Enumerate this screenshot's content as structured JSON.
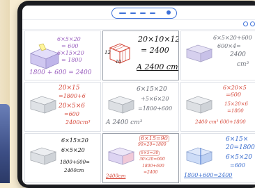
{
  "app": {
    "title": "",
    "breadcrumbs": []
  },
  "toolbar": {
    "tool_icon": "pen-icon"
  },
  "cells": [
    {
      "lines": [
        "6×5×20",
        "= 600",
        "6×15×20",
        "= 1800",
        "1800 + 600 = 2400"
      ],
      "color": "purple"
    },
    {
      "lines": [
        "20×10×12",
        "= 2400",
        "A 2400 cm³"
      ],
      "labels": [
        "12",
        "10"
      ],
      "color": "black"
    },
    {
      "lines": [
        "6×5×20+600",
        "600×4=",
        "2400",
        "cm³"
      ],
      "color": "gray"
    },
    {
      "lines": [
        "20×15",
        "=1800+6",
        "20×5×6",
        "=600",
        "2400cm³"
      ],
      "color": "red"
    },
    {
      "lines": [
        "6×15×20",
        "+5×6×20",
        "=1800+600",
        "A 2400 cm³"
      ],
      "color": "gray"
    },
    {
      "lines": [
        "6×20×5",
        "=600",
        "15×20×6",
        "=1800",
        "2400 cm³ 600+1800"
      ],
      "color": "red"
    },
    {
      "lines": [
        "6×15×20",
        "6×5×20",
        "1800+600=",
        "2400cm"
      ],
      "color": "black"
    },
    {
      "lines": [
        "6×15=90",
        "90×20=1800",
        "6×5=30",
        "30×20=600",
        "1800+600",
        "=2400",
        "2400cm"
      ],
      "color": "red"
    },
    {
      "lines": [
        "6×15×",
        "20=1800",
        "6×5×20",
        "=600",
        "1800+600=2400"
      ],
      "color": "blue"
    }
  ],
  "colors": {
    "accent": "#3b6fd8",
    "background": "#f7ecd2"
  }
}
